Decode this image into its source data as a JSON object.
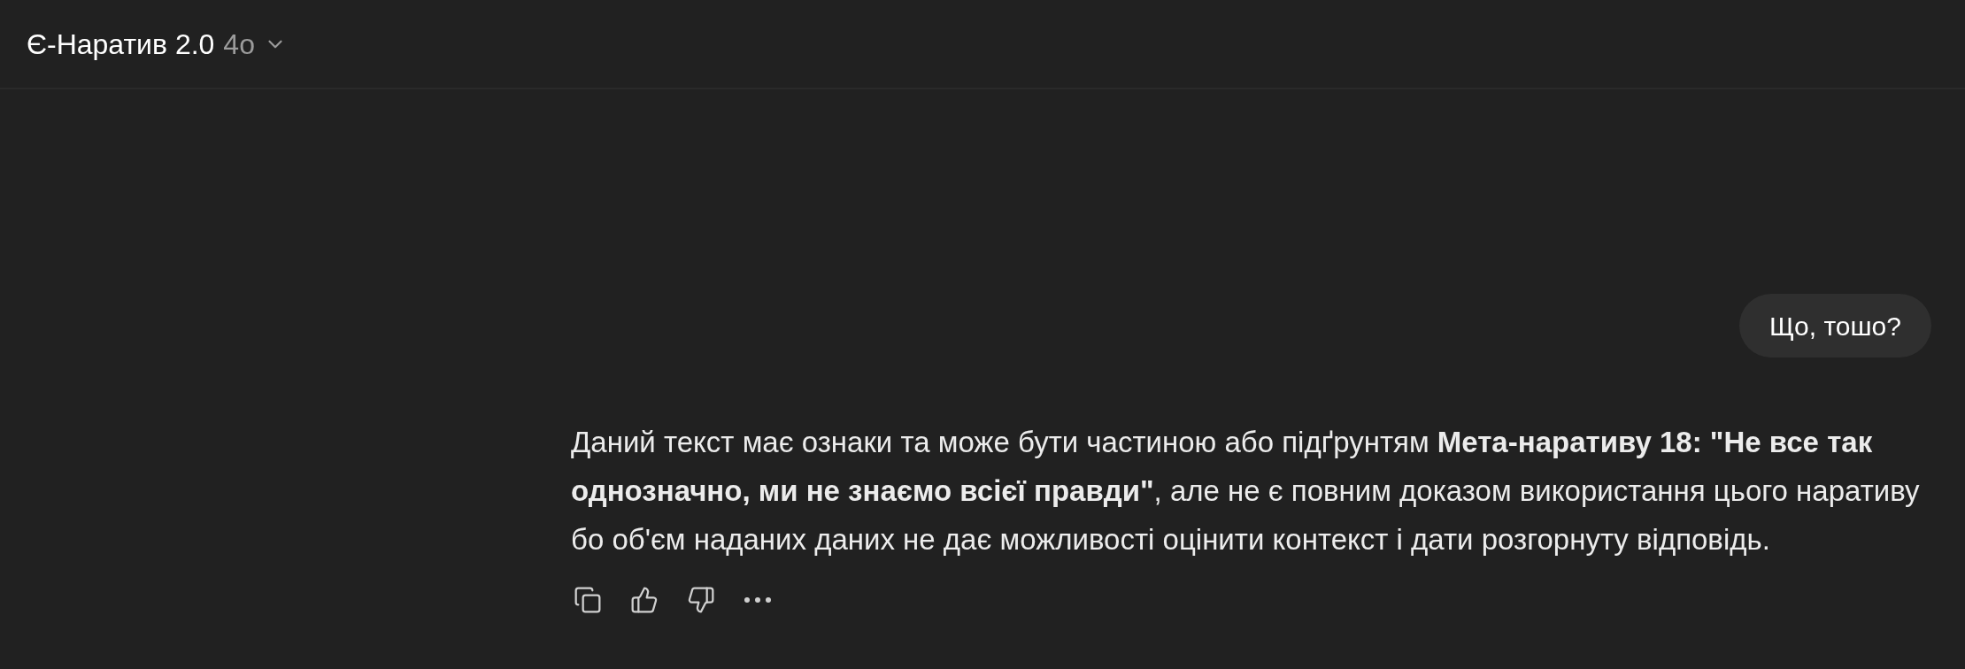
{
  "header": {
    "title": "Є-Наратив 2.0",
    "model": "4o"
  },
  "messages": [
    {
      "kind": "user",
      "text": "Що, тошо?"
    },
    {
      "kind": "assistant",
      "text": "Даний текст має ознаки та може бути частиною або підґрунтям **Мета-наративу 18: \"Не все так однозначно, ми не знаємо всієї правди\"**, але не є повним доказом використання цього наративу бо об'єм наданих даних не дає можливості оцінити контекст і дати розгорнуту відповідь."
    }
  ]
}
